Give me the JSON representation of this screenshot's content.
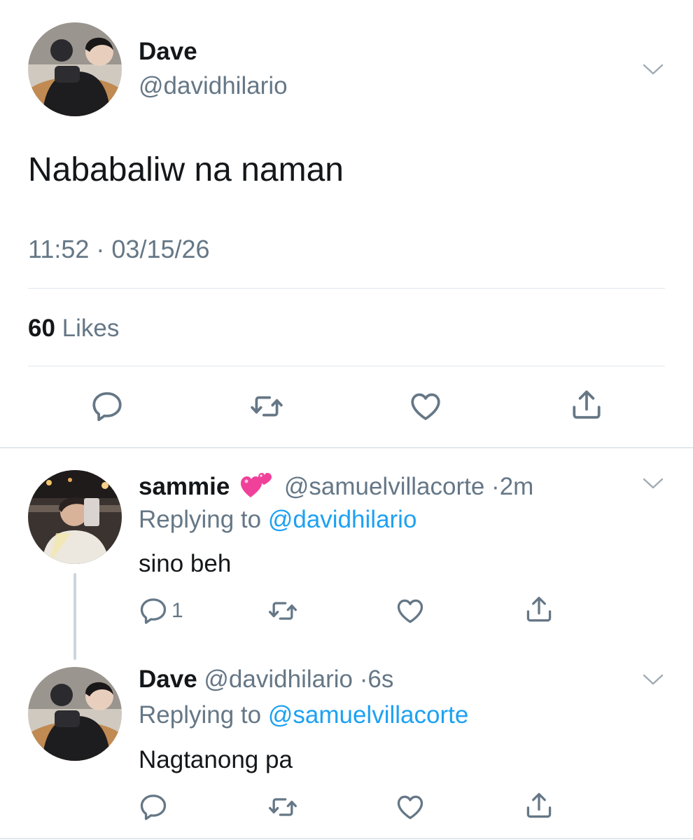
{
  "main_tweet": {
    "author_name": "Dave",
    "author_handle": "@davidhilario",
    "text": "Nababaliw na naman",
    "timestamp": "11:52 · 03/15/26",
    "likes_count": "60",
    "likes_label": "Likes",
    "actions": [
      "reply-icon",
      "retweet-icon",
      "like-icon",
      "share-icon"
    ]
  },
  "replies": [
    {
      "author_name": "sammie",
      "emoji": "two-hearts-emoji",
      "author_handle": "@samuelvillacorte",
      "separator": "·",
      "time": "2m",
      "replying_prefix": "Replying to",
      "replying_to": "@davidhilario",
      "text": "sino beh",
      "reply_count": "1"
    },
    {
      "author_name": "Dave",
      "author_handle": "@davidhilario",
      "separator": "·",
      "time": "6s",
      "replying_prefix": "Replying to",
      "replying_to": "@samuelvillacorte",
      "text": "Nagtanong pa",
      "reply_count": ""
    }
  ],
  "colors": {
    "text": "#14171a",
    "secondary": "#657786",
    "link": "#1da1f2",
    "divider": "#e1e8ed",
    "icon": "#657786"
  }
}
